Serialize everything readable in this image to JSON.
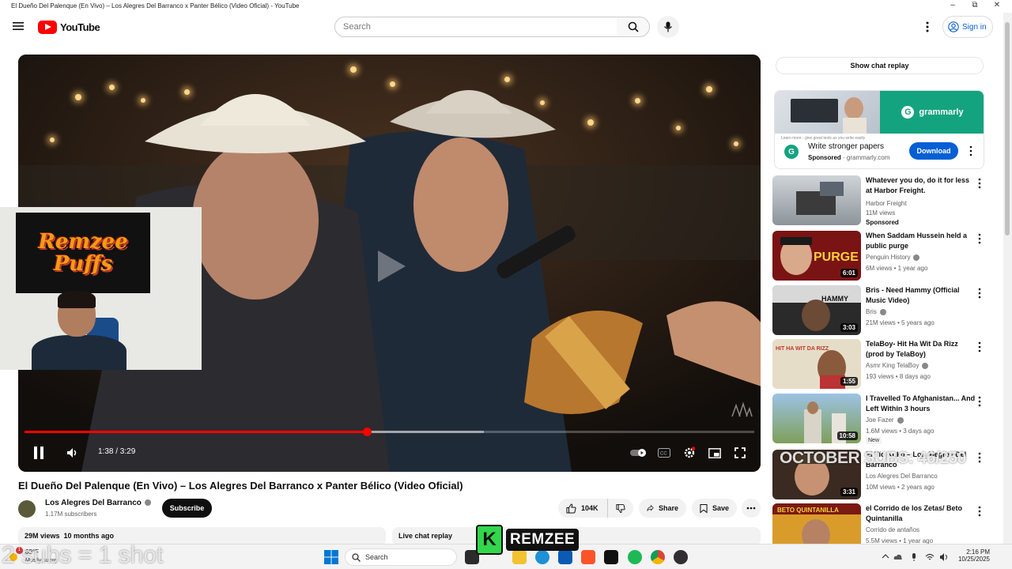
{
  "window": {
    "title": "El Dueño Del Palenque (En Vivo) – Los Alegres Del Barranco x Panter Bélico (Video Oficial) - YouTube",
    "min": "–",
    "max": "⧉",
    "close": "✕"
  },
  "header": {
    "logo_text": "YouTube",
    "search_placeholder": "Search",
    "signin_label": "Sign in"
  },
  "player": {
    "time": "1:38 / 3:29",
    "progress_fraction": 0.469,
    "buffered_fraction": 0.63
  },
  "webcam": {
    "flag_line1": "Remzee",
    "flag_line2": "Puffs"
  },
  "video": {
    "title": "El Dueño Del Palenque (En Vivo) – Los Alegres Del Barranco x Panter Bélico (Video Oficial)",
    "channel": "Los Alegres Del Barranco",
    "subscribers": "1.17M subscribers",
    "subscribe_label": "Subscribe",
    "likes": "104K",
    "share_label": "Share",
    "save_label": "Save",
    "views": "29M views",
    "age": "10 months ago",
    "live_chat_replay": "Live chat replay"
  },
  "sidebar": {
    "chat_replay_label": "Show chat replay",
    "ad": {
      "brand": "grammarly",
      "small_text": "Learn more - give great texts as you write easily",
      "title": "Write stronger papers",
      "sponsored": "Sponsored",
      "domain": "grammarly.com",
      "cta": "Download"
    },
    "recommendations": [
      {
        "title": "Whatever you do, do it for less at Harbor Freight.",
        "channel": "Harbor Freight",
        "meta": "11M views",
        "badge": "Sponsored",
        "duration": "",
        "verified": false
      },
      {
        "title": "When Saddam Hussein held a public purge",
        "channel": "Penguin History",
        "meta": "6M views • 1 year ago",
        "badge": "",
        "duration": "6:01",
        "verified": true
      },
      {
        "title": "Bris - Need Hammy (Official Music Video)",
        "channel": "Bris",
        "meta": "21M views • 5 years ago",
        "badge": "",
        "duration": "3:03",
        "verified": true
      },
      {
        "title": "TelaBoy- Hit Ha Wit Da Rizz (prod by TelaBoy)",
        "channel": "Asmr King TelaBoy",
        "meta": "193 views • 8 days ago",
        "badge": "",
        "duration": "1:55",
        "verified": true
      },
      {
        "title": "I Travelled To Afghanistan... And Left Within 3 hours",
        "channel": "Joe Fazer",
        "meta": "1.6M views • 3 days ago",
        "badge": "New",
        "duration": "10:58",
        "verified": true
      },
      {
        "title": "El Tío Koko – Los Alegres Del Barranco",
        "channel": "Los Alegres Del Barranco",
        "meta": "10M views • 2 years ago",
        "badge": "",
        "duration": "3:31",
        "verified": false
      },
      {
        "title": "el Corrido de los Zetas/ Beto Quintanilla",
        "channel": "Corrido de antaños",
        "meta": "5.5M views • 1 year ago",
        "badge": "",
        "duration": "",
        "verified": false
      }
    ],
    "thumb_labels": {
      "purge": "PURGE",
      "hammy": "HAMMY",
      "rizz": "HIT HA WIT DA RIZZ",
      "beto": "BETO QUINTANILLA"
    }
  },
  "overlays": {
    "subs_goal": "OCTOBER SUBS: 46/250",
    "shot_text": "2 subs = 1 shot",
    "remzee_k": "K",
    "remzee_text": "REMZEE"
  },
  "taskbar": {
    "weather_temp": "69°F",
    "weather_desc": "Mostly sunny",
    "notif_count": "1",
    "search_label": "Search",
    "time": "2:16 PM",
    "date": "10/25/2025"
  },
  "colors": {
    "youtube_red": "#ff0000",
    "link_blue": "#065fd4",
    "grammarly_green": "#14a37f"
  }
}
